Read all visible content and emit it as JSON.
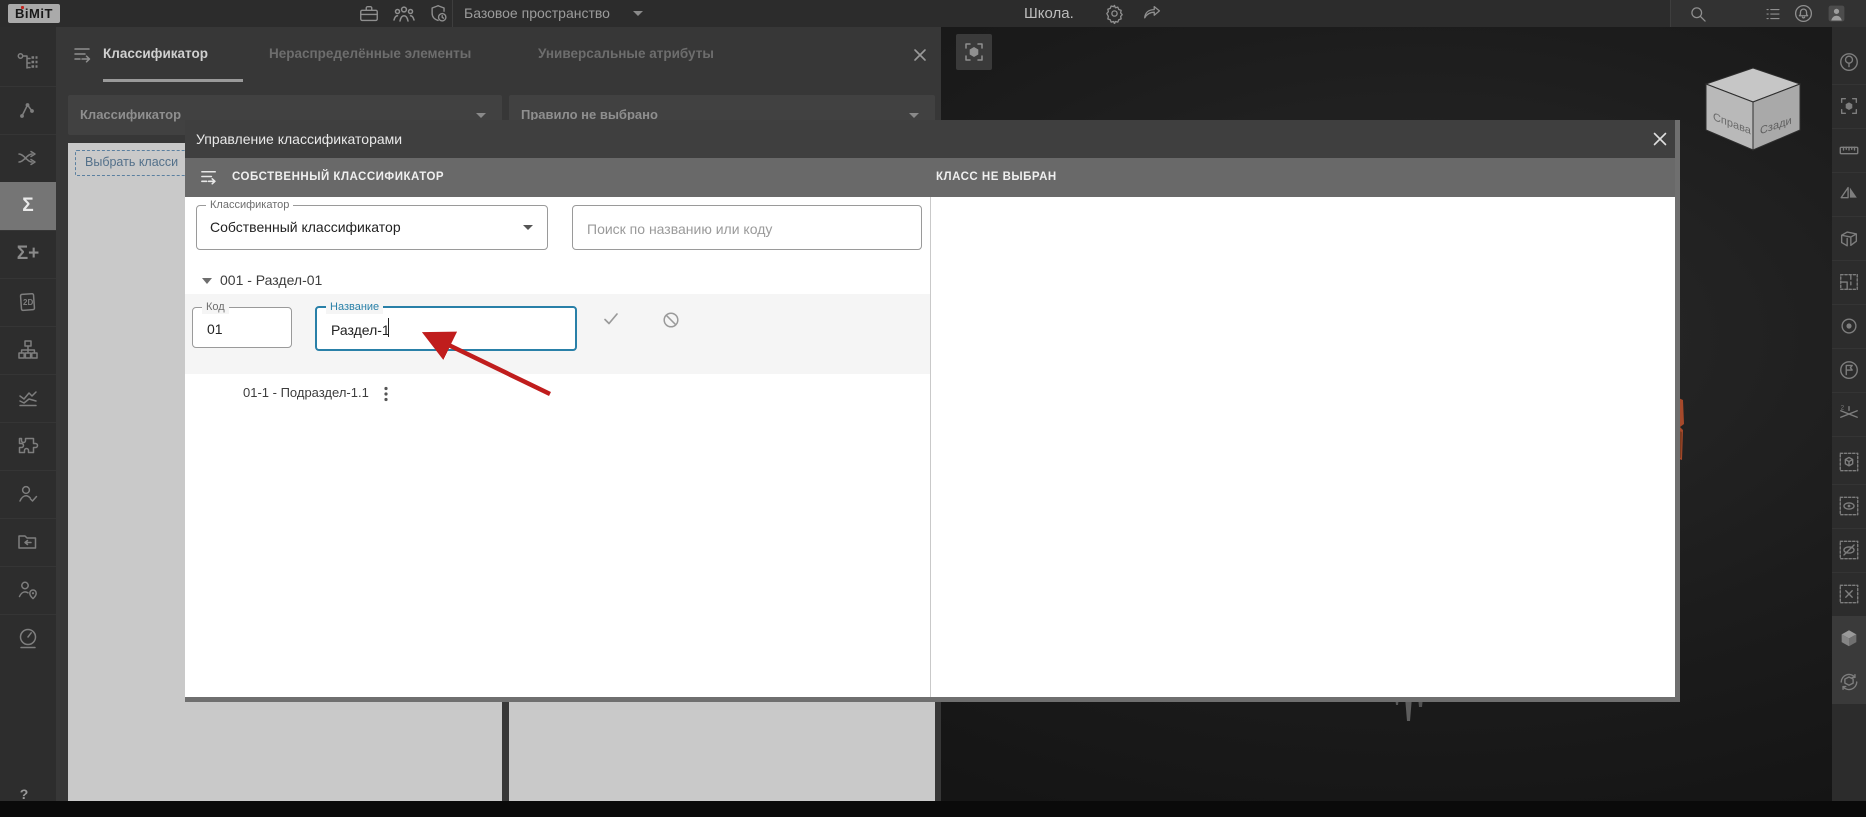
{
  "topbar": {
    "logo": "BiMiT",
    "workspace_selector": "Базовое пространство",
    "project_name": "Школа.",
    "icons": [
      "briefcase-icon",
      "team-icon",
      "shield-clock-icon",
      "gear-icon",
      "share-icon",
      "search-icon",
      "list-icon",
      "notifications-icon",
      "account-icon"
    ]
  },
  "sidebar": {
    "icons": [
      "tree-structure-icon",
      "connector-icon",
      "shuffle-icon",
      "sigma-icon",
      "sigma-plus-icon",
      "sheet-2d-icon",
      "org-chart-icon",
      "line-chart-icon",
      "puzzle-icon",
      "person-check-icon",
      "folder-import-icon",
      "person-location-icon",
      "gauge-icon"
    ],
    "sigma_glyph": "Σ",
    "sigma_plus_glyph": "Σ+",
    "sheet_2d_glyph": "2D"
  },
  "panel": {
    "tabs": [
      {
        "label": "Классификатор",
        "active": true
      },
      {
        "label": "Нераспределённые элементы",
        "active": false
      },
      {
        "label": "Универсальные атрибуты",
        "active": false
      }
    ],
    "filters": {
      "classifier_label": "Классификатор",
      "rule_label": "Правило не выбрано"
    },
    "select_class_button": "Выбрать класси"
  },
  "modal": {
    "title": "Управление классификаторами",
    "left_header": "СОБСТВЕННЫЙ КЛАССИФИКАТОР",
    "right_header": "КЛАСС НЕ ВЫБРАН",
    "classifier_select": {
      "label": "Классификатор",
      "value": "Собственный классификатор"
    },
    "search": {
      "placeholder": "Поиск по названию или коду"
    },
    "tree": {
      "root_item": "001 - Раздел-01",
      "edit_row": {
        "code_label": "Код",
        "code_value": "01",
        "name_label": "Название",
        "name_value": "Раздел-1"
      },
      "child_item": "01-1 - Подраздел-1.1"
    }
  },
  "viewport": {
    "nav_cube": {
      "left_face": "Справа",
      "right_face": "Сзади"
    },
    "toolbar_icons": [
      "tree-in-circle-icon",
      "frame-hexagon-icon",
      "ruler-icon",
      "flip-icon",
      "box-3d-icon",
      "floorplan-icon",
      "target-icon",
      "flag-circle-icon",
      "axes-2-icon",
      "selection-cube-icon",
      "selection-eye-icon",
      "selection-eye-off-icon",
      "selection-clear-icon",
      "solid-cube-icon",
      "cube-refresh-icon"
    ]
  },
  "help_button": "?",
  "colors": {
    "accent_focus": "#2980a8",
    "annotation_arrow": "#c01d1d",
    "modal_header": "#696969",
    "panel_gray": "#c9c9c9",
    "viewport_bg": "#1d1d1d"
  }
}
